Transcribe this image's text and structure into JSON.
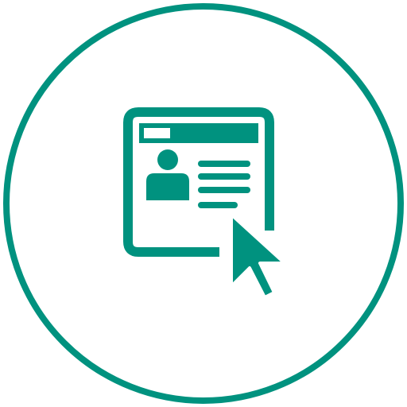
{
  "icon": {
    "name": "profile-page-click-icon",
    "parts": [
      "circle-border",
      "browser-window-icon",
      "user-avatar-icon",
      "text-lines",
      "mouse-pointer-icon"
    ]
  },
  "colors": {
    "accent": "#00927f",
    "background": "#ffffff"
  }
}
